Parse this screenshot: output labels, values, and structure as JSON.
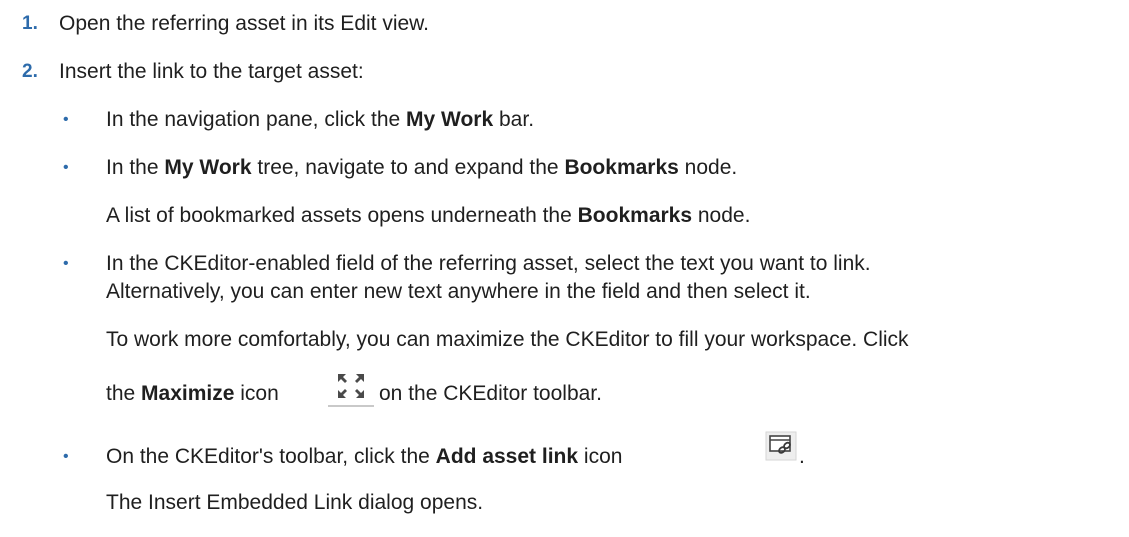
{
  "steps": [
    {
      "number": "1.",
      "text": "Open the referring asset in its Edit view."
    },
    {
      "number": "2.",
      "text": "Insert the link to the target asset:"
    }
  ],
  "substeps": {
    "s1": {
      "pre": "In the navigation pane, click the ",
      "bold": "My Work",
      "post": " bar."
    },
    "s2": {
      "pre": "In the ",
      "bold1": "My Work",
      "mid": " tree, navigate to and expand the ",
      "bold2": "Bookmarks",
      "post": " node."
    },
    "s2_note": {
      "pre": "A list of bookmarked assets opens underneath the ",
      "bold": "Bookmarks",
      "post": " node."
    },
    "s3": {
      "line1": "In the CKEditor-enabled field of the referring asset, select the text you want to link.",
      "line2": "Alternatively, you can enter new text anywhere in the field and then select it."
    },
    "s3_note": {
      "line1": "To work more comfortably, you can maximize the CKEditor to fill your workspace. Click",
      "pre": "the ",
      "bold": "Maximize",
      "mid": " icon",
      "post": " on the CKEditor toolbar."
    },
    "s4": {
      "pre": "On the CKEditor's toolbar, click the ",
      "bold": "Add asset link",
      "mid": " icon",
      "post": "."
    },
    "s4_note": "The Insert Embedded Link dialog opens."
  },
  "bullet_char": "•",
  "icons": [
    "maximize-icon",
    "add-asset-link-icon"
  ],
  "colors": {
    "accent": "#2d6bab",
    "text": "#1f1f1f"
  }
}
